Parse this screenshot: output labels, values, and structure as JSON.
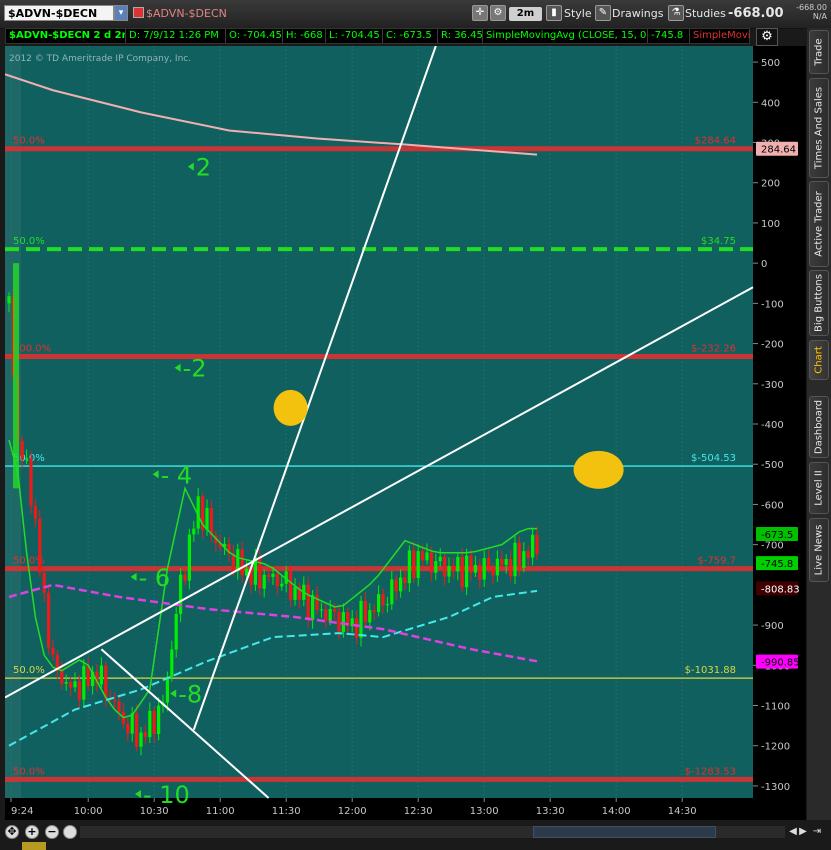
{
  "header": {
    "symbol": "$ADVN-$DECN",
    "symbol_desc": "$ADVN-$DECN",
    "aggregation": "2m",
    "style_label": "Style",
    "drawings_label": "Drawings",
    "studies_label": "Studies",
    "last_price": "-668.00",
    "last_small": "-668.00",
    "last_na": "N/A"
  },
  "info": {
    "title": "$ADVN-$DECN 2 d 2m",
    "date": "D: 7/9/12 1:26 PM",
    "open": "O: -704.45",
    "high": "H: -668",
    "low": "L: -704.45",
    "close": "C: -673.5",
    "range": "R: 36.45",
    "study": "SimpleMovingAvg (CLOSE, 15, 0)",
    "study_val": "-745.8",
    "study2": "SimpleMovi..."
  },
  "chart_data": {
    "type": "line",
    "copyright": "2012 © TD Ameritrade IP Company, Inc.",
    "ylim": [
      -1330,
      540
    ],
    "y_ticks": [
      500,
      400,
      300,
      200,
      100,
      0,
      -100,
      -200,
      -300,
      -400,
      -500,
      -600,
      -700,
      -900,
      -1000,
      -1100,
      -1200,
      -1300
    ],
    "x_ticks": [
      "9:24",
      "10:00",
      "10:30",
      "11:00",
      "11:30",
      "12:00",
      "12:30",
      "13:00",
      "13:30",
      "14:00",
      "14:30"
    ],
    "fib_levels": [
      {
        "pct": "50.0%",
        "label": "$284.64",
        "value": 284.64,
        "color": "#e03030"
      },
      {
        "pct": "50.0%",
        "label": "$34.75",
        "value": 34.75,
        "color": "#22dd22"
      },
      {
        "pct": "100.0%",
        "label": "$-232.26",
        "value": -232.26,
        "color": "#e03030"
      },
      {
        "pct": "50.0%",
        "label": "$-504.53",
        "value": -504.53,
        "color": "#44e8e8"
      },
      {
        "pct": "50.0%",
        "label": "$-759.7",
        "value": -759.7,
        "color": "#e03030"
      },
      {
        "pct": "50.0%",
        "label": "$-1031.88",
        "value": -1031.88,
        "color": "#d8d840"
      },
      {
        "pct": "50.0%",
        "label": "$-1283.53",
        "value": -1283.53,
        "color": "#e03030"
      }
    ],
    "price_tags": [
      {
        "label": "284.64",
        "value": 284.64,
        "bg": "#f0b0b0",
        "fg": "#000000"
      },
      {
        "label": "-673.5",
        "value": -673.5,
        "bg": "#00c000",
        "fg": "#000000"
      },
      {
        "label": "-745.8",
        "value": -745.8,
        "bg": "#00d000",
        "fg": "#000000"
      },
      {
        "label": "-808.83",
        "value": -808.83,
        "bg": "#400000",
        "fg": "#ffffff"
      },
      {
        "label": "-990.85",
        "value": -990.85,
        "bg": "#ff00ff",
        "fg": "#000000"
      }
    ],
    "annotations": [
      "2",
      "-2",
      "- 4",
      "- 6",
      "-8",
      "- 10"
    ],
    "series": [
      {
        "name": "$ADVN-$DECN",
        "type": "bars",
        "up_color": "#00ee00",
        "down_color": "#ee0000"
      },
      {
        "name": "SimpleMovingAvg (CLOSE, 15, 0)",
        "values_last": -745.8,
        "color": "#22dd22"
      }
    ]
  },
  "sidebar": {
    "tabs": [
      "Trade",
      "Times And Sales",
      "Active Trader",
      "Big Buttons",
      "Chart",
      "Dashboard",
      "Level II",
      "Live News"
    ]
  }
}
